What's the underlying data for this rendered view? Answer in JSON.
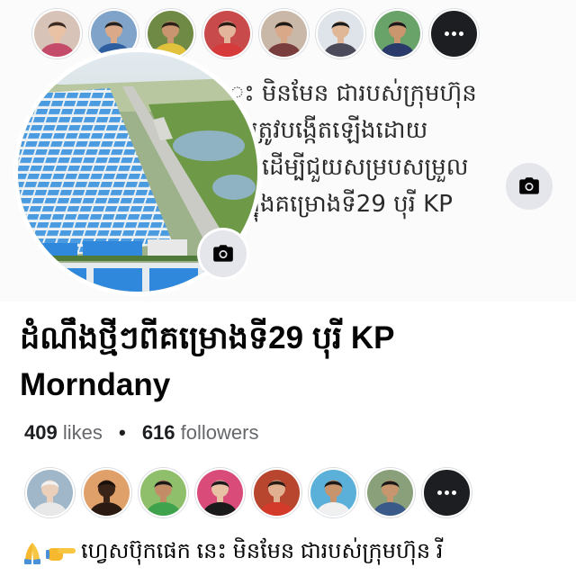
{
  "cover": {
    "text_lines": [
      "ះ មិនមែន ជារបស់ក្រុមហ៊ុន",
      "ាត្រូវបង្កើតឡើងដោយ",
      "ះ ដើម្បីជួយសម្របសម្រួល",
      "នក្នុងគម្រោងទី29 បុរី KP"
    ],
    "camera_icon": "camera-icon",
    "top_avatars": [
      {
        "bg": "#d8c3b8",
        "skin": "#e9c2a6",
        "hair": "#3a2a22",
        "shirt": "#c44b6a"
      },
      {
        "bg": "#7fa3c9",
        "skin": "#d9a98a",
        "hair": "#222222",
        "shirt": "#2d5fa0"
      },
      {
        "bg": "#6f8a45",
        "skin": "#c99570",
        "hair": "#2a2018",
        "shirt": "#e2c23a"
      },
      {
        "bg": "#c84a4a",
        "skin": "#e3b59a",
        "hair": "#2a1a14",
        "shirt": "#d63a3a"
      },
      {
        "bg": "#c9b8a8",
        "skin": "#d8a888",
        "hair": "#1e1a18",
        "shirt": "#7a3d3d"
      },
      {
        "bg": "#dfe4ea",
        "skin": "#e0b898",
        "hair": "#1a1a1a",
        "shirt": "#4a4a5a"
      },
      {
        "bg": "#6aa36a",
        "skin": "#c9966e",
        "hair": "#1a1a1a",
        "shirt": "#2a3a6a"
      },
      {
        "type": "more",
        "icon": "more-dots-icon"
      }
    ]
  },
  "profile": {
    "camera_icon": "camera-icon"
  },
  "page": {
    "name": "ដំណឹងថ្មីៗពីគម្រោងទី29 បុរី KP Morndany",
    "likes_count": "409",
    "likes_label": "likes",
    "separator": "•",
    "followers_count": "616",
    "followers_label": "followers"
  },
  "friends": {
    "avatars": [
      {
        "bg": "#9fb7c9",
        "skin": "#ead0bb",
        "hair": "#f2f2f2",
        "shirt": "#e8e8e8"
      },
      {
        "bg": "#e0a06a",
        "skin": "#3a2418",
        "hair": "#1a100a",
        "shirt": "#2a1a12"
      },
      {
        "bg": "#8fbf6a",
        "skin": "#c28c66",
        "hair": "#1a1a1a",
        "shirt": "#3fa34d"
      },
      {
        "bg": "#d94c7a",
        "skin": "#e8c0a4",
        "hair": "#1a1a1a",
        "shirt": "#1a1a1a"
      },
      {
        "bg": "#b8462e",
        "skin": "#e0b090",
        "hair": "#2a1a14",
        "shirt": "#d43a2a"
      },
      {
        "bg": "#5ab0d8",
        "skin": "#c8946e",
        "hair": "#1a1a1a",
        "shirt": "#f0f0f0"
      },
      {
        "bg": "#8aa07a",
        "skin": "#c8966e",
        "hair": "#1a1a1a",
        "shirt": "#3a5a8a"
      },
      {
        "type": "more",
        "icon": "more-dots-icon"
      }
    ]
  },
  "post": {
    "icons": [
      "folded-hands-icon",
      "pointing-right-icon"
    ],
    "text": "ហ្វេសប៊ុកផេក នេះ មិនមែន ជារបស់ក្រុមហ៊ុន រី"
  },
  "colors": {
    "camera_button_bg": "#e4e6eb",
    "secondary_text": "#65676b",
    "primary_text": "#050505",
    "roof_blue": "#2f88dc"
  }
}
